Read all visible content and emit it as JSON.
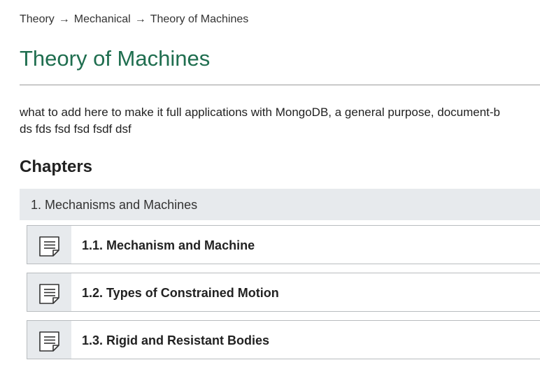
{
  "breadcrumb": {
    "items": [
      "Theory",
      "Mechanical",
      "Theory of Machines"
    ],
    "separator": "→"
  },
  "page": {
    "title": "Theory of Machines",
    "description_line1": "what to add here to make it full applications with MongoDB, a general purpose, document-b",
    "description_line2": "ds fds fsd fsd fsdf dsf"
  },
  "chapters": {
    "heading": "Chapters",
    "chapter_title": "1. Mechanisms and Machines",
    "sections": [
      {
        "label": "1.1. Mechanism and Machine",
        "icon": "document-icon"
      },
      {
        "label": "1.2. Types of Constrained Motion",
        "icon": "document-icon"
      },
      {
        "label": "1.3. Rigid and Resistant Bodies",
        "icon": "document-icon"
      }
    ]
  },
  "colors": {
    "title_green": "#1f6e4f",
    "panel_gray": "#e7eaed",
    "border_gray": "#b8bcbf"
  }
}
